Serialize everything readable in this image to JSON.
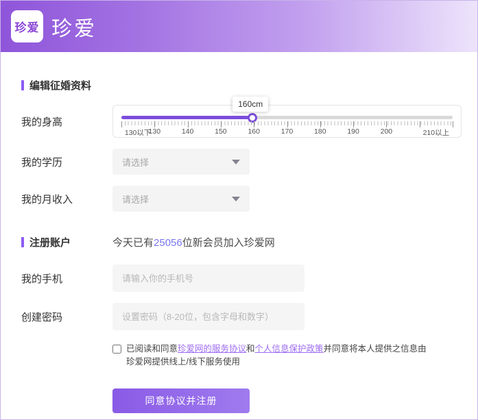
{
  "header": {
    "logo_text": "珍爱",
    "brand_text": "珍爱"
  },
  "profile_section": {
    "title": "编辑征婚资料",
    "height": {
      "label": "我的身高",
      "value_tooltip": "160cm",
      "ruler_labels": [
        "130以下",
        "130",
        "140",
        "150",
        "160",
        "170",
        "180",
        "190",
        "200",
        "210以上"
      ]
    },
    "education": {
      "label": "我的学历",
      "placeholder": "请选择"
    },
    "income": {
      "label": "我的月收入",
      "placeholder": "请选择"
    }
  },
  "register_section": {
    "title": "注册账户",
    "stats_prefix": "今天已有",
    "stats_count": "25056",
    "stats_suffix": "位新会员加入珍爱网",
    "phone": {
      "label": "我的手机",
      "placeholder": "请输入你的手机号"
    },
    "password": {
      "label": "创建密码",
      "placeholder": "设置密码（8-20位，包含字母和数字）"
    },
    "agreement": {
      "prefix": "已阅读和同意",
      "link1": "珍爱网的服务协议",
      "middle": "和",
      "link2": "个人信息保护政策",
      "suffix": "并同意将本人提供之信息由珍爱网提供线上/线下服务使用"
    },
    "submit_label": "同意协议并注册"
  },
  "colors": {
    "accent": "#8b5cf6",
    "slider_fill": "#7c4ddc",
    "stats_number": "#7b76f1",
    "link": "#9e6df2"
  }
}
